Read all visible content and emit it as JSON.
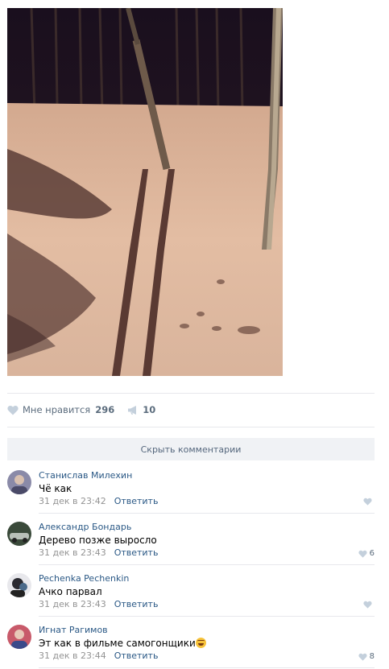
{
  "post": {
    "photo_icon": "photo-night-forest-ski-track"
  },
  "actions": {
    "like_icon": "heart-icon",
    "like_label": "Мне нравится",
    "like_count": "296",
    "share_icon": "megaphone-icon",
    "share_count": "10"
  },
  "comments_toggle": "Скрыть комментарии",
  "comments": [
    {
      "author": "Станислав Милехин",
      "text": "Чё как",
      "date": "31 дек в 23:42",
      "reply": "Ответить",
      "likes": ""
    },
    {
      "author": "Александр Бондарь",
      "text": "Дерево позже выросло",
      "date": "31 дек в 23:43",
      "reply": "Ответить",
      "likes": "6"
    },
    {
      "author": "Pechenka Pechenkin",
      "text": "Ачко парвал",
      "date": "31 дек в 23:43",
      "reply": "Ответить",
      "likes": ""
    },
    {
      "author": "Игнат Рагимов",
      "text": "Эт как в фильме самогонщики",
      "date": "31 дек в 23:44",
      "reply": "Ответить",
      "likes": "8"
    }
  ],
  "colors": {
    "link": "#2a5885",
    "muted": "#939393",
    "action": "#5b6c7d",
    "toggle_bg": "#f0f2f5"
  }
}
